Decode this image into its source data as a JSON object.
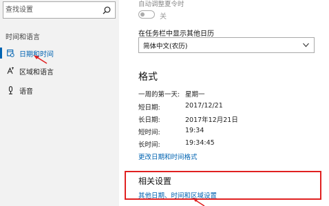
{
  "sidebar": {
    "search": {
      "placeholder": "查找设置"
    },
    "section_title": "时间和语言",
    "items": [
      {
        "label": "日期和时间",
        "icon": "calendar-clock-icon",
        "active": true
      },
      {
        "label": "区域和语言",
        "icon": "region-language-icon",
        "active": false
      },
      {
        "label": "语音",
        "icon": "microphone-icon",
        "active": false
      }
    ]
  },
  "main": {
    "auto_timezone_label": "自动调整夏令时",
    "auto_timezone_toggle_state": "关",
    "taskbar_calendar_label": "在任务栏中显示其他日历",
    "taskbar_calendar_value": "简体中文(农历)",
    "format": {
      "heading": "格式",
      "rows": [
        {
          "label": "一周的第一天:",
          "value": "星期一"
        },
        {
          "label": "短日期:",
          "value": "2017/12/21"
        },
        {
          "label": "长日期:",
          "value": "2017年12月21日"
        },
        {
          "label": "短时间:",
          "value": "19:34"
        },
        {
          "label": "长时间:",
          "value": "19:34:45"
        }
      ],
      "change_link": "更改日期和时间格式"
    },
    "related": {
      "heading": "相关设置",
      "link": "其他日期、时间和区域设置"
    }
  },
  "colors": {
    "accent": "#0063b1",
    "annotation_red": "#e02020",
    "sidebar_bg": "#f2f2f2"
  }
}
